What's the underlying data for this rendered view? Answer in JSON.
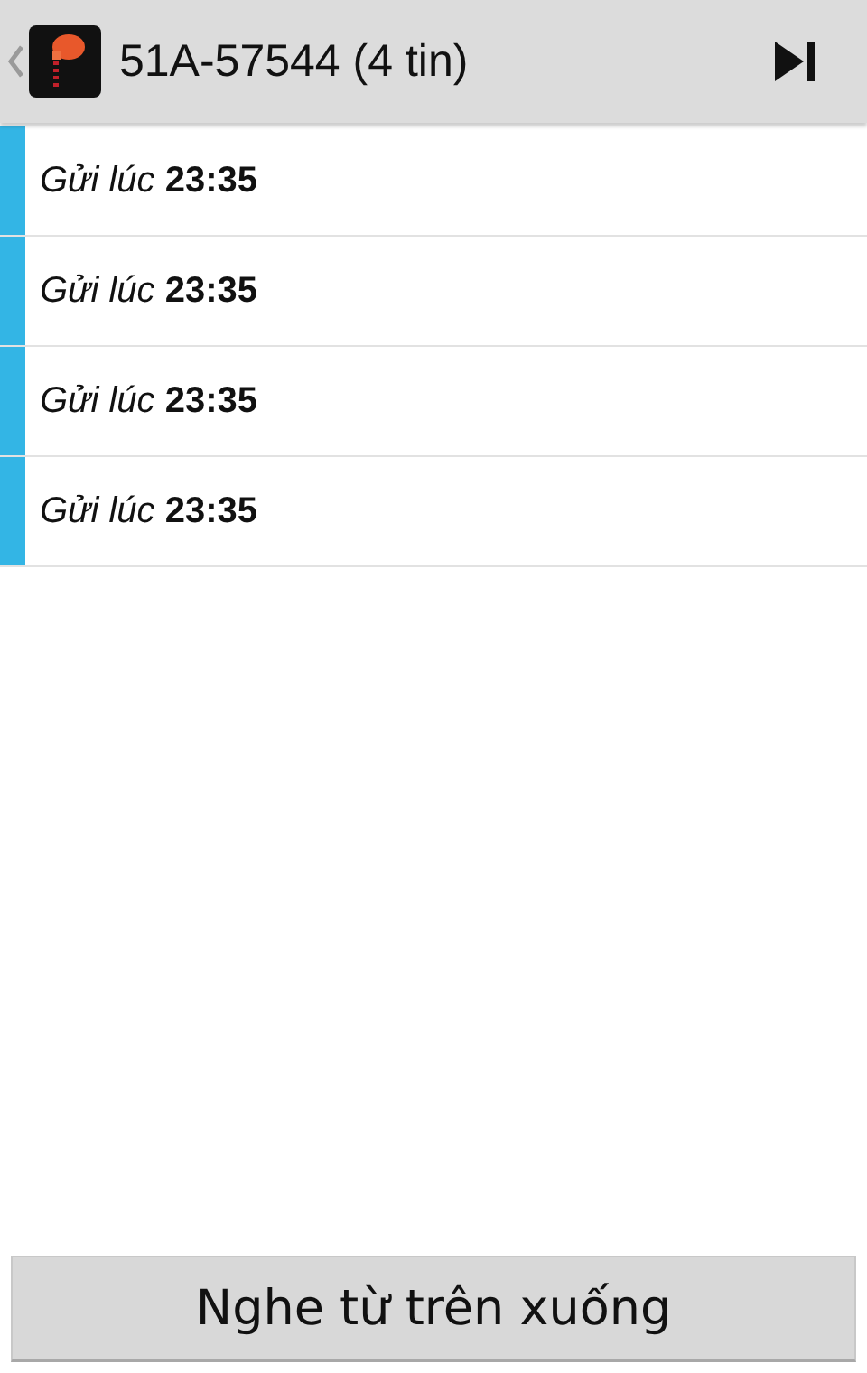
{
  "header": {
    "title": "51A-57544 (4 tin)"
  },
  "messages": [
    {
      "text": "*Gửi lúc* **23:35**"
    },
    {
      "text": "*Gửi lúc* **23:35**"
    },
    {
      "text": "*Gửi lúc* **23:35**"
    },
    {
      "text": "*Gửi lúc* **23:35**"
    }
  ],
  "footer_button": {
    "label": "Nghe từ trên xuống"
  }
}
